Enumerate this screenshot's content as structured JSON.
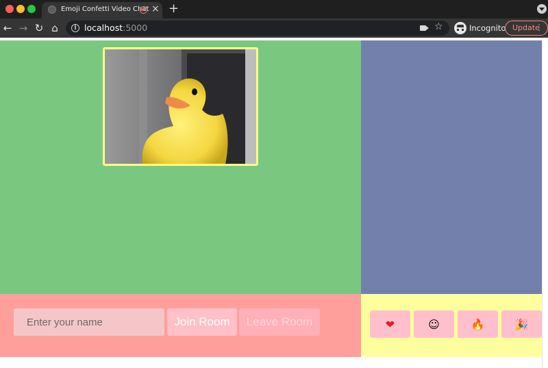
{
  "browser": {
    "tab": {
      "title": "Emoji Confetti Video Chat",
      "close_glyph": "×",
      "favicon": "globe-icon",
      "indicator": "recording-icon"
    },
    "new_tab_glyph": "+",
    "nav": {
      "back_glyph": "←",
      "forward_glyph": "→",
      "reload_glyph": "↻",
      "home_glyph": "⌂"
    },
    "address": {
      "host": "localhost",
      "port": ":5000",
      "info_glyph": "i"
    },
    "star_glyph": "☆",
    "profile_label": "Incognito",
    "update_label": "Update",
    "update_menu_glyph": "⋮"
  },
  "controls": {
    "name_placeholder": "Enter your name",
    "join_label": "Join Room",
    "leave_label": "Leave Room"
  },
  "emojis": [
    {
      "name": "heart",
      "glyph": "❤"
    },
    {
      "name": "smile",
      "glyph": "☺"
    },
    {
      "name": "fire",
      "glyph": "🔥"
    },
    {
      "name": "party",
      "glyph": "🎉"
    }
  ],
  "colors": {
    "video_area": "#7ac880",
    "side_panel": "#7380ac",
    "control_bar": "#ff9f9c",
    "emoji_bar": "#ffff9e",
    "video_border": "#ffff8a",
    "update_accent": "#f28b82"
  }
}
